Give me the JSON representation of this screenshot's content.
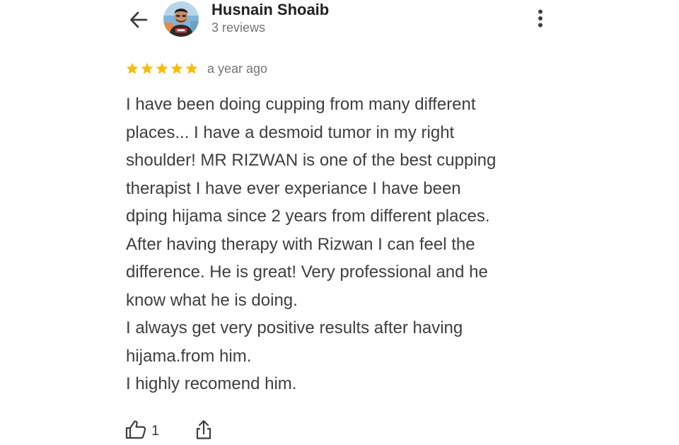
{
  "header": {
    "back_icon": "arrow-left-icon",
    "author_name": "Husnain Shoaib",
    "review_count": "3 reviews",
    "more_icon": "more-vertical-icon"
  },
  "review": {
    "rating": 5,
    "rating_max": 5,
    "star_color": "#fbbc04",
    "date": "a year ago",
    "lines": [
      "I have been doing cupping from many different",
      "places... I have a desmoid tumor in my right",
      "shoulder! MR RIZWAN is one of the best cupping",
      "therapist I have ever experiance I have been",
      "dping hijama since 2 years from different places.",
      "After having therapy with Rizwan I can feel the",
      "difference. He is great! Very professional and he",
      "know what he is doing.",
      "I always get very positive results after having",
      "hijama.from him.",
      "I highly recomend him."
    ]
  },
  "actions": {
    "like_icon": "thumbs-up-icon",
    "like_count": "1",
    "share_icon": "share-icon"
  }
}
